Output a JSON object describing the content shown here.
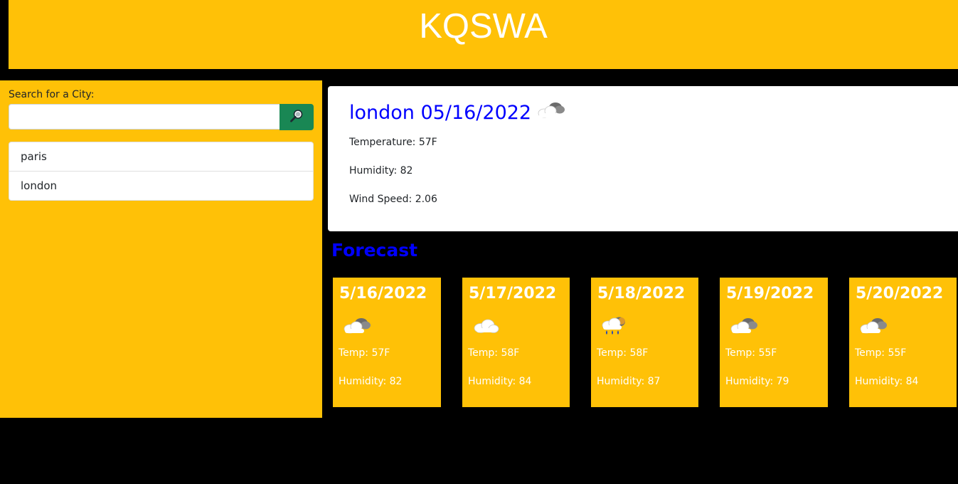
{
  "header": {
    "title": "KQSWA"
  },
  "search": {
    "label": "Search for a City:",
    "value": "",
    "placeholder": "",
    "button_icon": "search-icon"
  },
  "history": [
    {
      "label": "paris"
    },
    {
      "label": "london"
    }
  ],
  "current": {
    "heading": "london 05/16/2022",
    "icon": "partly-cloudy-icon",
    "temperature": "Temperature: 57F",
    "humidity": "Humidity: 82",
    "wind": "Wind Speed: 2.06"
  },
  "forecast": {
    "title": "Forecast",
    "days": [
      {
        "date": "5/16/2022",
        "icon": "partly-cloudy-icon",
        "temp": "Temp: 57F",
        "humidity": "Humidity: 82"
      },
      {
        "date": "5/17/2022",
        "icon": "cloud-icon",
        "temp": "Temp: 58F",
        "humidity": "Humidity: 84"
      },
      {
        "date": "5/18/2022",
        "icon": "rain-icon",
        "temp": "Temp: 58F",
        "humidity": "Humidity: 87"
      },
      {
        "date": "5/19/2022",
        "icon": "partly-cloudy-icon",
        "temp": "Temp: 55F",
        "humidity": "Humidity: 79"
      },
      {
        "date": "5/20/2022",
        "icon": "partly-cloudy-icon",
        "temp": "Temp: 55F",
        "humidity": "Humidity: 84"
      }
    ]
  },
  "colors": {
    "accent": "#ffc107",
    "button": "#198754",
    "heading": "#0000ff",
    "background": "#000000"
  }
}
